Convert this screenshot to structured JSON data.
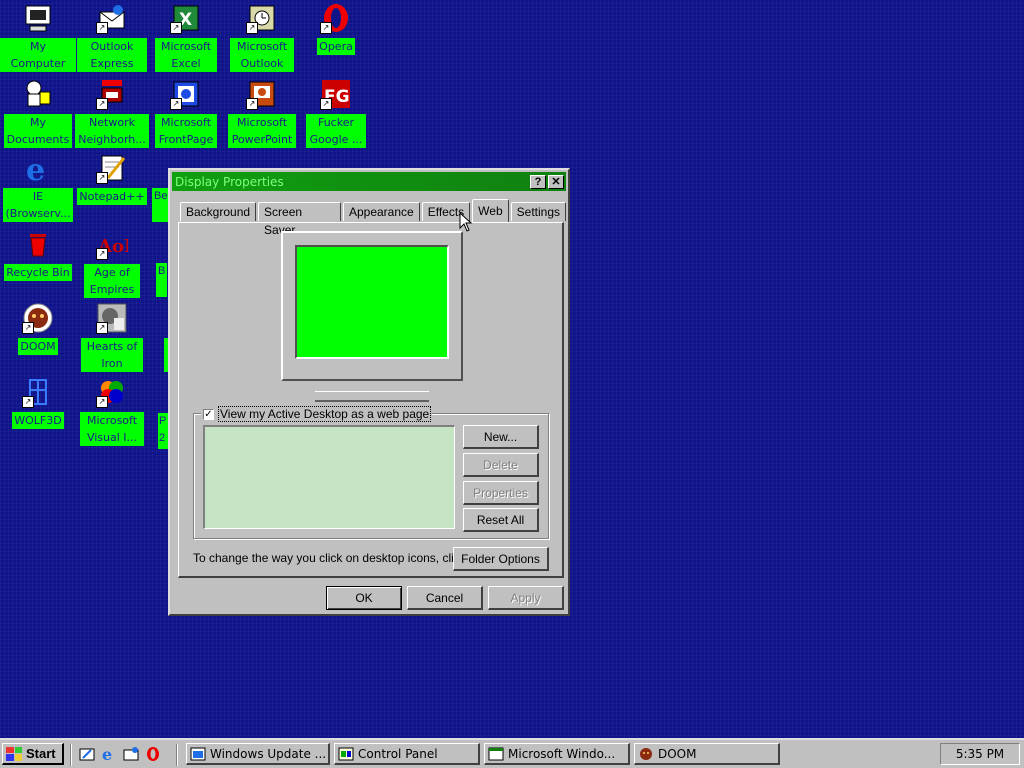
{
  "desktop": {
    "icons": [
      {
        "label": "My Computer"
      },
      {
        "label": "Outlook Express"
      },
      {
        "label": "Microsoft Excel"
      },
      {
        "label": "Microsoft Outlook"
      },
      {
        "label": "Opera"
      },
      {
        "label": "My Documents"
      },
      {
        "label": "Network Neighborh..."
      },
      {
        "label": "Microsoft FrontPage"
      },
      {
        "label": "Microsoft PowerPoint"
      },
      {
        "label": "Fucker Google ..."
      },
      {
        "label": "IE (Browserv..."
      },
      {
        "label": "Notepad++"
      },
      {
        "label": "Recycle Bin"
      },
      {
        "label": "Age of Empires"
      },
      {
        "label": "DOOM"
      },
      {
        "label": "Hearts of Iron"
      },
      {
        "label": "WOLF3D"
      },
      {
        "label": "Microsoft Visual I..."
      }
    ],
    "partial_labels": [
      "Be",
      "B",
      "P",
      "2"
    ]
  },
  "dialog": {
    "title": "Display Properties",
    "help_button": "?",
    "close_button": "✕",
    "tabs": [
      {
        "label": "Background"
      },
      {
        "label": "Screen Saver"
      },
      {
        "label": "Appearance"
      },
      {
        "label": "Effects"
      },
      {
        "label": "Web"
      },
      {
        "label": "Settings"
      }
    ],
    "active_tab": "Web",
    "checkbox_label": "View my Active Desktop as a web page",
    "checkbox_checked": true,
    "buttons": {
      "new": "New...",
      "delete": "Delete",
      "properties": "Properties",
      "reset_all": "Reset All",
      "folder_options": "Folder Options",
      "ok": "OK",
      "cancel": "Cancel",
      "apply": "Apply"
    },
    "hint_text": "To change the way you click on desktop icons, click:"
  },
  "taskbar": {
    "start_label": "Start",
    "tasks": [
      {
        "label": "Windows Update ..."
      },
      {
        "label": "Control Panel"
      },
      {
        "label": "Microsoft Windo..."
      },
      {
        "label": "DOOM"
      }
    ],
    "clock": "5:35 PM"
  },
  "colors": {
    "desktop_bg": "#10148a",
    "icon_label_bg": "#00ff00",
    "title_bar": "#108010",
    "title_text": "#7dff7d",
    "monitor_screen": "#00ff00",
    "listbox_bg": "#c4e4c4"
  }
}
